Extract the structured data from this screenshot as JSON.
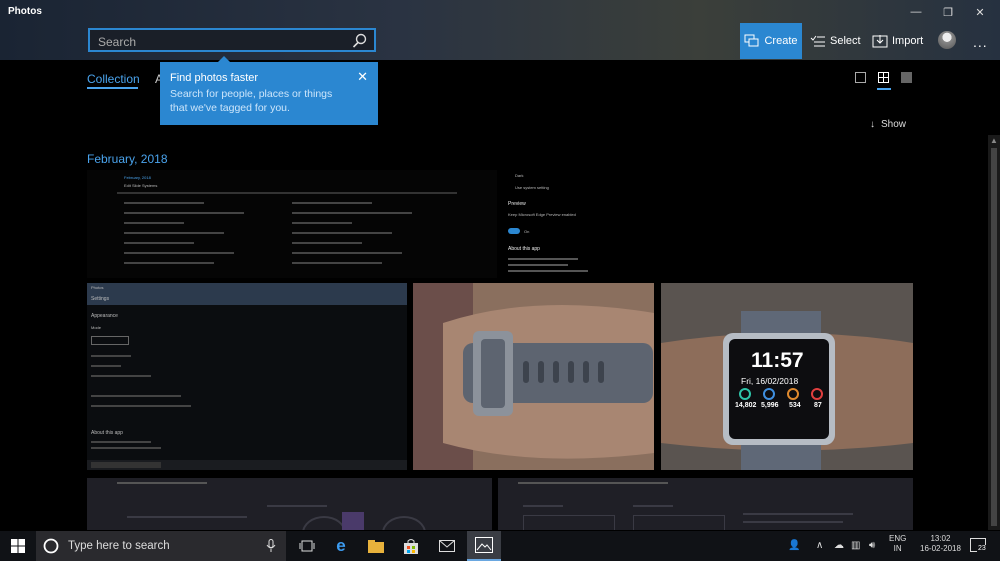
{
  "app": {
    "title": "Photos"
  },
  "window": {
    "minimize": "—",
    "maximize": "❐",
    "close": "✕"
  },
  "search": {
    "placeholder": "Search"
  },
  "toolbar": {
    "create_label": "Create",
    "select_label": "Select",
    "import_label": "Import",
    "more_label": "..."
  },
  "tabs": {
    "collection": "Collection",
    "albums": "A"
  },
  "tooltip": {
    "title": "Find photos faster",
    "body": "Search for people, places or things that we've tagged for you.",
    "close": "✕"
  },
  "show": {
    "label": "Show",
    "icon": "↓"
  },
  "section": {
    "date": "February, 2018"
  },
  "photos": {
    "settings_shot_1": {
      "title": "February, 2018",
      "menu": "Edit   Slide   Systems"
    },
    "settings_shot_2": {
      "off_label": "Dark",
      "on_label": "Use system setting",
      "preview_heading": "Preview",
      "preview_text": "Keep Microsoft Edge Preview enabled",
      "toggle_label": "On",
      "about_heading": "About this app"
    },
    "settings_shot_3": {
      "header": "Photos",
      "title": "Settings",
      "section": "Appearance",
      "sub": "Mode",
      "about": "About this app"
    },
    "watch": {
      "time": "11:57",
      "date": "Fri, 16/02/2018",
      "stat1": "14,802",
      "stat2": "5,996",
      "stat3": "534",
      "stat4": "87"
    }
  },
  "taskbar": {
    "search_placeholder": "Type here to search",
    "lang_line1": "ENG",
    "lang_line2": "IN",
    "time": "13:02",
    "date": "16-02-2018",
    "notifications": "23"
  },
  "colors": {
    "accent": "#2b87d1",
    "link": "#4aa3ec",
    "background": "#000000"
  }
}
